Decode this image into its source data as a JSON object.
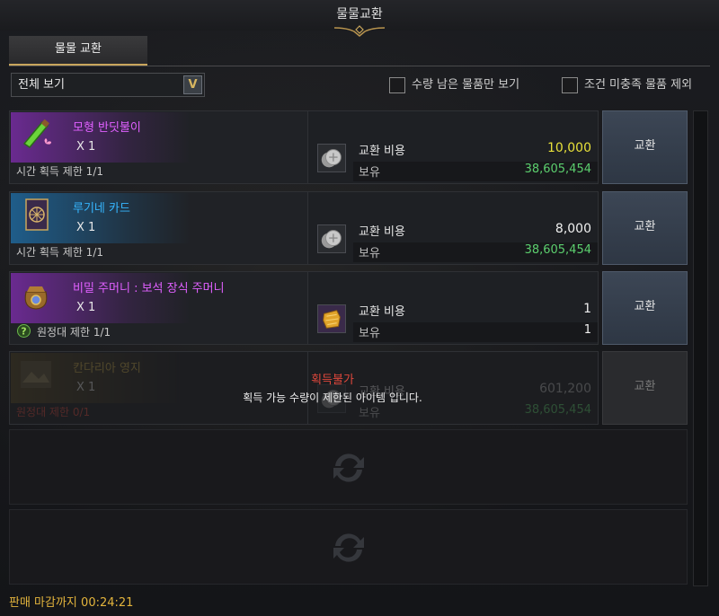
{
  "window": {
    "title": "물물교환"
  },
  "tabs": [
    {
      "label": "물물 교환",
      "active": true
    }
  ],
  "filter": {
    "selected": "전체 보기"
  },
  "options": [
    {
      "label": "수량 남은 물품만 보기",
      "checked": false
    },
    {
      "label": "조건 미충족 물품 제외",
      "checked": false
    }
  ],
  "items": [
    {
      "name": "모형 반딧불이",
      "name_color": "#e060ff",
      "rarity_color": "#7a2aa8",
      "qty": "X 1",
      "limit": "시간 획득 제한 1/1",
      "icon": "firefly-bottle-icon",
      "cost_label": "교환 비용",
      "cost": "10,000",
      "cost_color": "#e8e13a",
      "cost_icon": "silver-coin-icon",
      "own_label": "보유",
      "own": "38,605,454",
      "own_color": "#5ccf6e",
      "button": "교환",
      "enabled": true
    },
    {
      "name": "루기네 카드",
      "name_color": "#36b6ff",
      "rarity_color": "#1f5d8a",
      "qty": "X 1",
      "limit": "시간 획득 제한 1/1",
      "icon": "card-icon",
      "cost_label": "교환 비용",
      "cost": "8,000",
      "cost_color": "#f0f0f0",
      "cost_icon": "silver-coin-icon",
      "own_label": "보유",
      "own": "38,605,454",
      "own_color": "#5ccf6e",
      "button": "교환",
      "enabled": true
    },
    {
      "name": "비밀 주머니 : 보석 장식 주머니",
      "name_color": "#e060ff",
      "rarity_color": "#7a2aa8",
      "qty": "X 1",
      "limit": "원정대 제한 1/1",
      "limit_icon": "question-icon",
      "icon": "gem-pouch-icon",
      "cost_label": "교환 비용",
      "cost": "1",
      "cost_color": "#f0f0f0",
      "cost_icon": "gold-fragment-icon",
      "own_label": "보유",
      "own": "1",
      "own_color": "#f0f0f0",
      "button": "교환",
      "enabled": true
    },
    {
      "name": "칸다리아 영지",
      "name_color": "#d4b24a",
      "rarity_color": "#5a4a20",
      "qty": "X 1",
      "limit": "원정대 제한 0/1",
      "icon": "territory-icon",
      "cost_label": "교환 비용",
      "cost": "601,200",
      "cost_color": "#bbbbbb",
      "cost_icon": "silver-coin-icon",
      "own_label": "보유",
      "own": "38,605,454",
      "own_color": "#5ccf6e",
      "button": "교환",
      "enabled": false
    }
  ],
  "notice": {
    "title": "획득불가",
    "message": "획득 가능 수량이 제한된 아이템 입니다."
  },
  "empty_slot_icon": "exchange-arrows-icon",
  "footer": {
    "label": "판매 마감까지",
    "time": "00:24:21"
  }
}
